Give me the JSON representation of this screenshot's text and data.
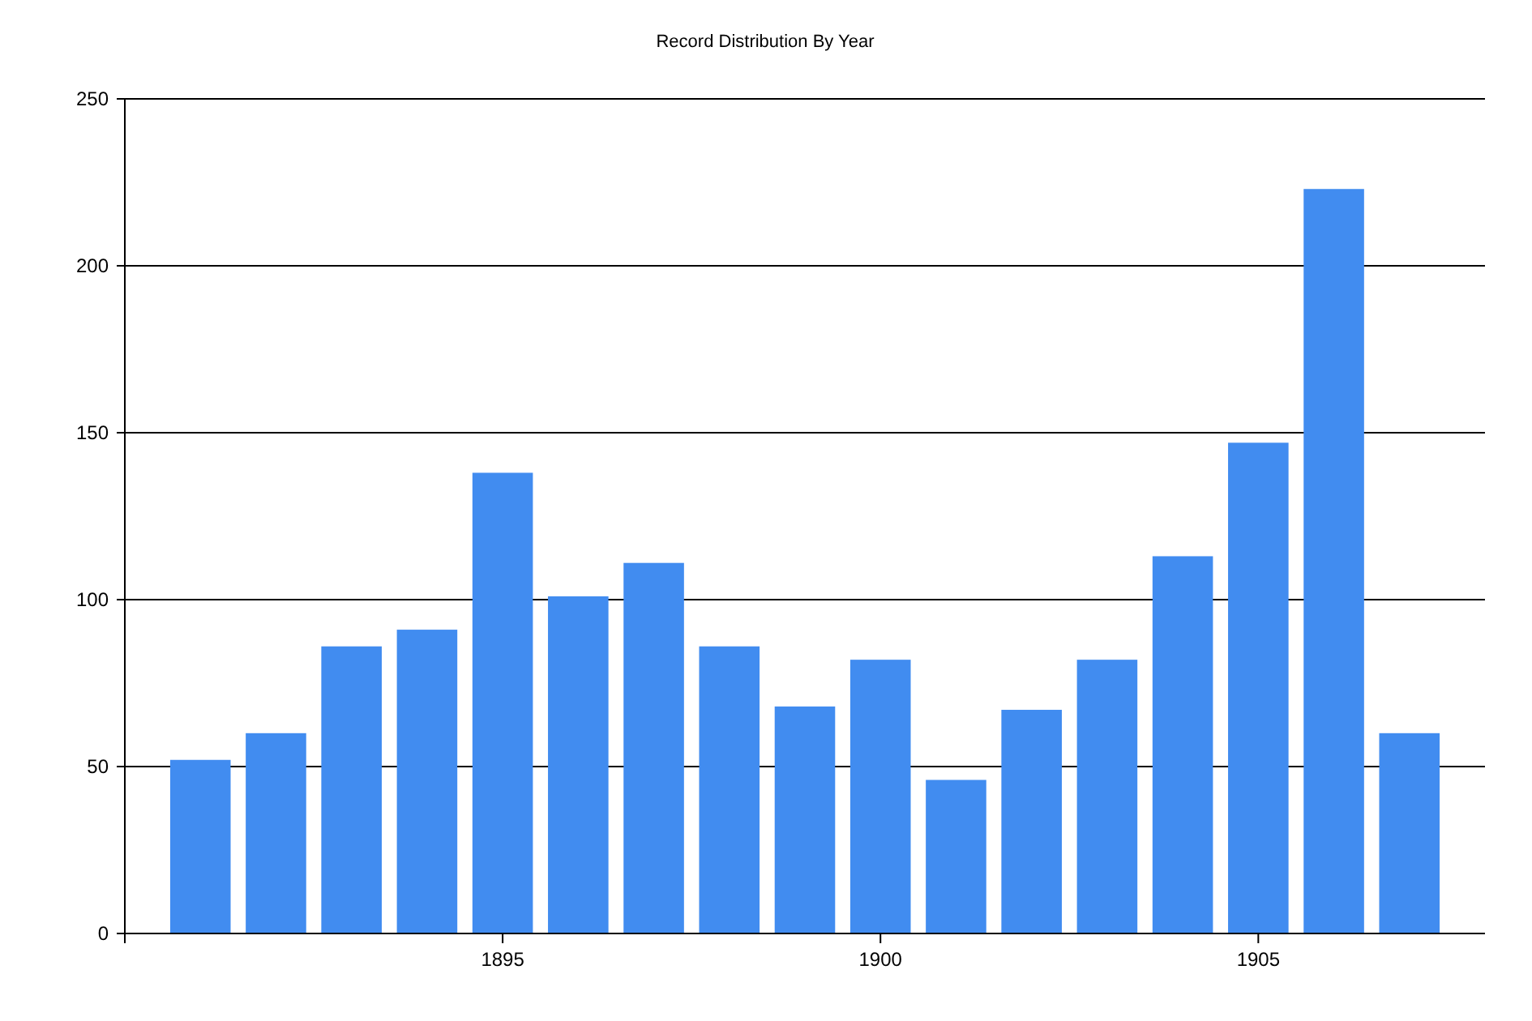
{
  "chart_data": {
    "type": "bar",
    "title": "Record Distribution By Year",
    "x": [
      1891,
      1892,
      1893,
      1894,
      1895,
      1896,
      1897,
      1898,
      1899,
      1900,
      1901,
      1902,
      1903,
      1904,
      1905,
      1906,
      1907
    ],
    "values": [
      52,
      60,
      86,
      91,
      138,
      101,
      111,
      86,
      68,
      82,
      46,
      67,
      82,
      113,
      147,
      223,
      60
    ],
    "xlim": [
      1890,
      1908
    ],
    "ylim": [
      0,
      250
    ],
    "xticks": [
      1895,
      1900,
      1905
    ],
    "yticks": [
      0,
      50,
      100,
      150,
      200,
      250
    ],
    "grid": true
  }
}
